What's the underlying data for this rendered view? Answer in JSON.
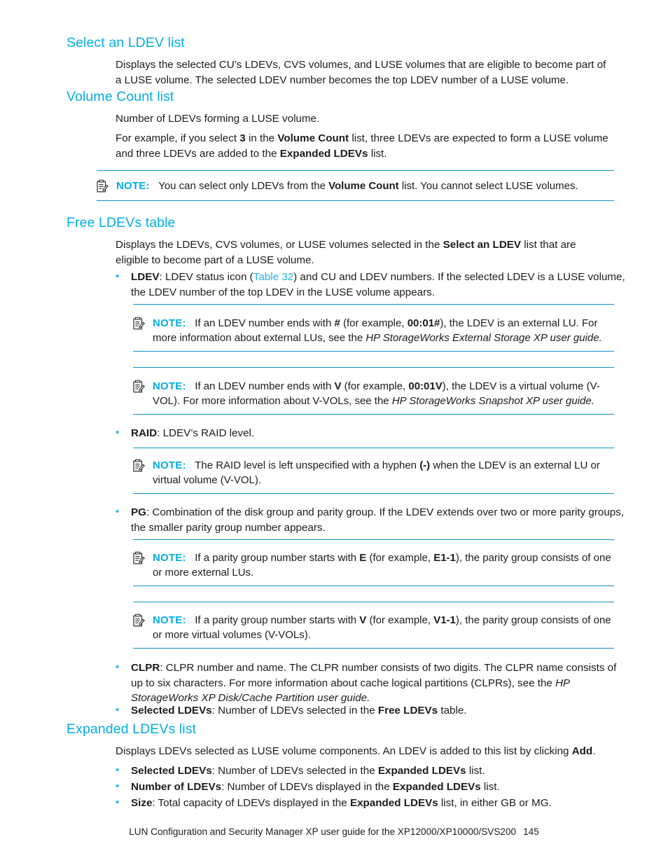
{
  "document": {
    "footer_text": "LUN Configuration and Security Manager XP user guide for the XP12000/XP10000/SVS200",
    "page_number": "145"
  },
  "colors": {
    "heading": "#00ade6",
    "rule": "#0b92d0",
    "bullet": "#27b3e8",
    "link": "#27b3e8",
    "body_text": "#1c1c1c"
  },
  "sections": {
    "select_ldev_list": {
      "heading": "Select an LDEV list",
      "paragraph": "Displays the selected CU’s LDEVs, CVS volumes, and LUSE volumes that are eligible to become part of a LUSE volume. The selected LDEV number becomes the top LDEV number of a LUSE volume."
    },
    "volume_count_list": {
      "heading": "Volume Count list",
      "paragraph_1": "Number of LDEVs forming a LUSE volume.",
      "paragraph_2_pre": "For example, if you select ",
      "paragraph_2_b1": "3",
      "paragraph_2_mid1": " in the ",
      "paragraph_2_b2": "Volume Count",
      "paragraph_2_mid2": " list, three LDEVs are expected to form a LUSE volume and three LDEVs are added to the ",
      "paragraph_2_b3": "Expanded LDEVs",
      "paragraph_2_post": " list.",
      "note": {
        "label": "NOTE:",
        "pre": "You can select only LDEVs from the ",
        "bold": "Volume Count",
        "post": " list. You cannot select LUSE volumes."
      }
    },
    "free_ldevs_table": {
      "heading": "Free LDEVs table",
      "intro_pre": "Displays the LDEVs, CVS volumes, or LUSE volumes selected in the ",
      "intro_bold": "Select an LDEV",
      "intro_post": " list that are eligible to become part of a LUSE volume.",
      "bullets": {
        "ldev": {
          "term": "LDEV",
          "pre": ": LDEV status icon (",
          "link": "Table 32",
          "post": ") and CU and LDEV numbers. If the selected LDEV is a LUSE volume, the LDEV number of the top LDEV in the LUSE volume appears."
        },
        "raid": {
          "term": "RAID",
          "text": ": LDEV’s RAID level."
        },
        "pg": {
          "term": "PG",
          "text": ": Combination of the disk group and parity group. If the LDEV extends over two or more parity groups, the smaller parity group number appears."
        },
        "clpr": {
          "term": "CLPR",
          "text": ": CLPR number and name. The CLPR number consists of two digits. The CLPR name consists of up to six characters. For more information about cache logical partitions (CLPRs), see the ",
          "italic": "HP StorageWorks XP Disk/Cache Partition user guide."
        },
        "selected_ldevs": {
          "term": "Selected LDEVs",
          "pre": ": Number of LDEVs selected in the ",
          "bold": "Free LDEVs",
          "post": " table."
        }
      },
      "notes": {
        "hash_note": {
          "label": "NOTE:",
          "pre": "If an LDEV number ends with ",
          "bold_1": "#",
          "mid": " (for example, ",
          "bold_2": "00:01#",
          "post": "), the LDEV is an external LU. For more information about external LUs, see the ",
          "italic": "HP StorageWorks External Storage XP user guide."
        },
        "v_note": {
          "label": "NOTE:",
          "pre": "If an LDEV number ends with ",
          "bold_1": "V",
          "mid": " (for example, ",
          "bold_2": "00:01V",
          "post": "), the LDEV is a virtual volume (V-VOL). For more information about V-VOLs, see the ",
          "italic": "HP StorageWorks Snapshot XP user guide."
        },
        "raid_note": {
          "label": "NOTE:",
          "pre": "The RAID level is left unspecified with a hyphen ",
          "bold_1": "(-)",
          "post": " when the LDEV is an external LU or virtual volume (V-VOL)."
        },
        "e_note": {
          "label": "NOTE:",
          "pre": "If a parity group number starts with ",
          "bold_1": "E",
          "mid": " (for example, ",
          "bold_2": "E1-1",
          "post": "), the parity group consists of one or more external LUs."
        },
        "v_pg_note": {
          "label": "NOTE:",
          "pre": "If a parity group number starts with ",
          "bold_1": "V",
          "mid": " (for example, ",
          "bold_2": "V1-1",
          "post": "), the parity group consists of one or more virtual volumes (V-VOLs)."
        }
      }
    },
    "expanded_ldevs_list": {
      "heading": "Expanded LDEVs list",
      "intro_pre": "Displays LDEVs selected as LUSE volume components. An LDEV is added to this list by clicking ",
      "intro_bold": "Add",
      "intro_post": ".",
      "bullets": {
        "selected_ldevs": {
          "term": "Selected LDEVs",
          "pre": ": Number of LDEVs selected in the ",
          "bold": "Expanded LDEVs",
          "post": " list."
        },
        "number_of_ldevs": {
          "term": "Number of LDEVs",
          "pre": ": Number of LDEVs displayed in the ",
          "bold": "Expanded LDEVs",
          "post": " list."
        },
        "size": {
          "term": "Size",
          "pre": ": Total capacity of LDEVs displayed in the ",
          "bold": "Expanded LDEVs",
          "post": " list, in either GB or MG."
        }
      }
    }
  },
  "icons": {
    "note_icon": "note-clipboard-pencil-icon"
  }
}
